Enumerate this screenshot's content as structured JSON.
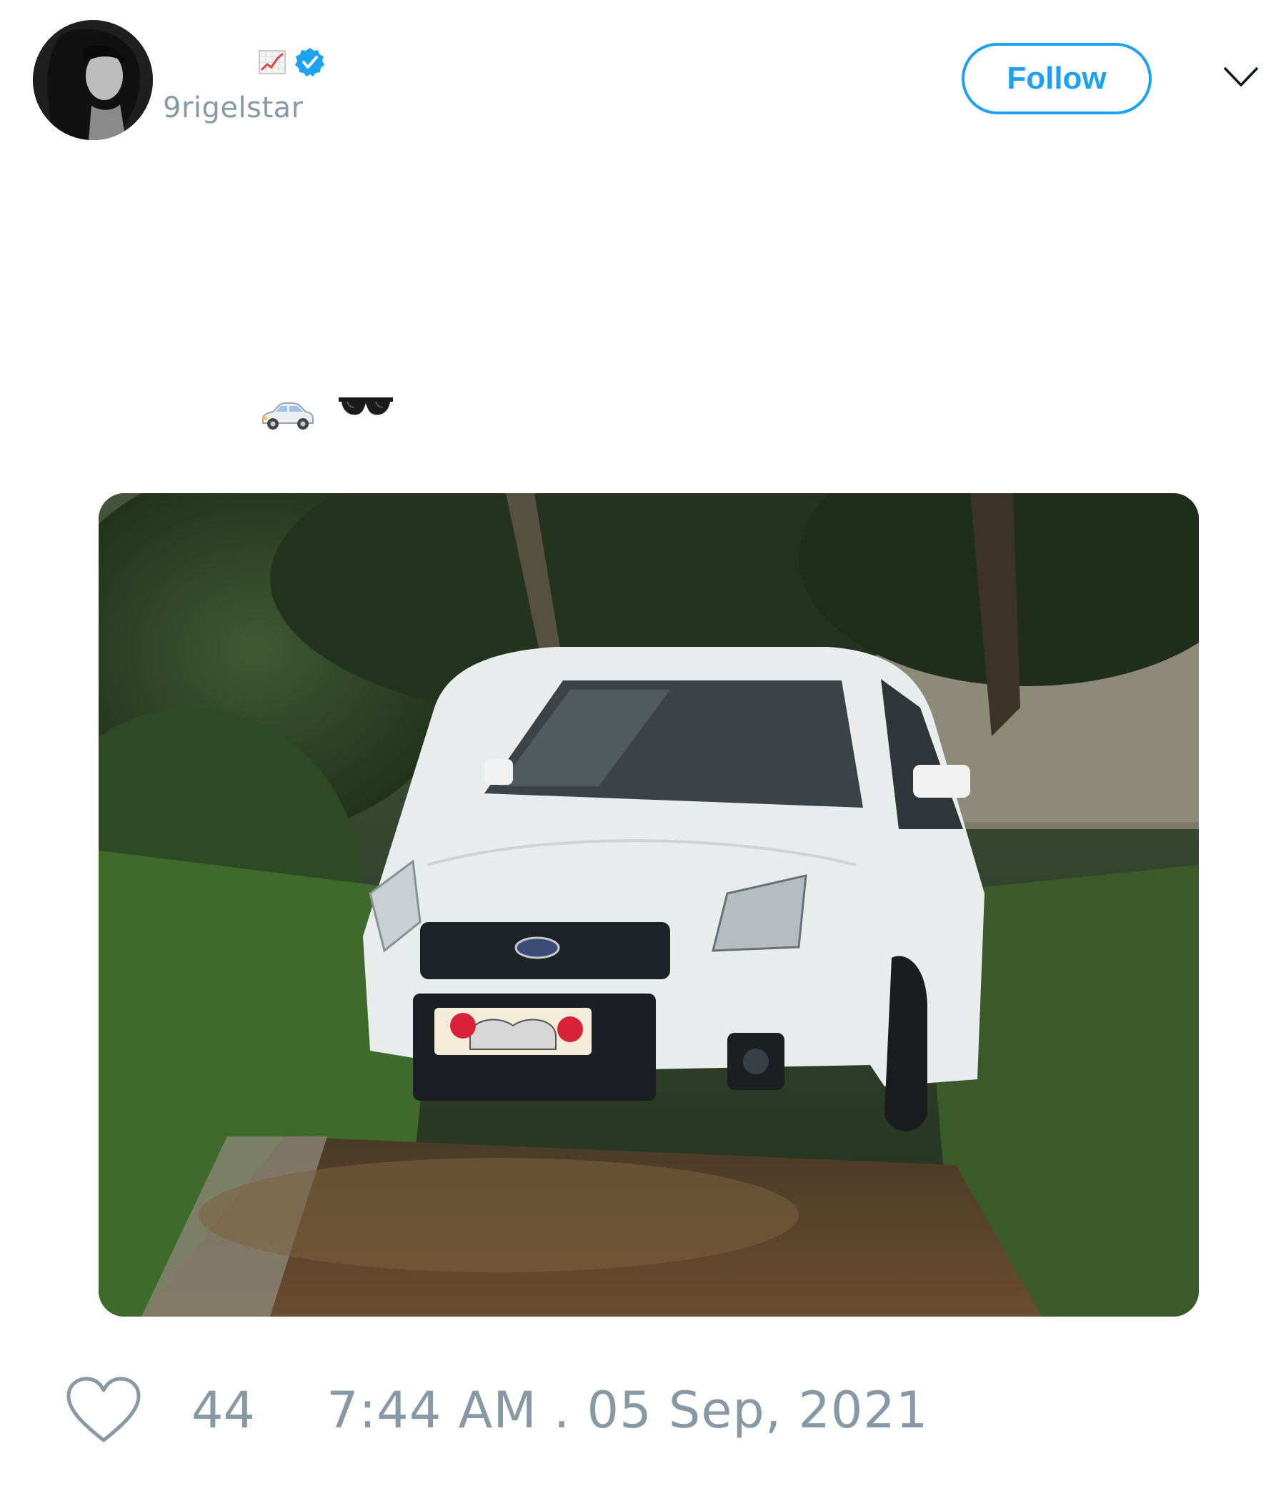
{
  "tweet": {
    "author": {
      "handle": "9rigelstar",
      "name_emoji_icon": "chart-increasing-icon",
      "verified": true,
      "avatar": "avatar-photo"
    },
    "follow_label": "Follow",
    "more_icon": "chevron-down-icon",
    "text_emojis": [
      "car-icon",
      "sunglasses-icon"
    ],
    "media_description_icon": "white-hatchback-photo",
    "like_count": "44",
    "timestamp": "7:44 AM . 05 Sep, 2021"
  },
  "colors": {
    "accent": "#1da1f2",
    "muted": "#8899a6",
    "text": "#14171a",
    "background": "#ffffff"
  }
}
